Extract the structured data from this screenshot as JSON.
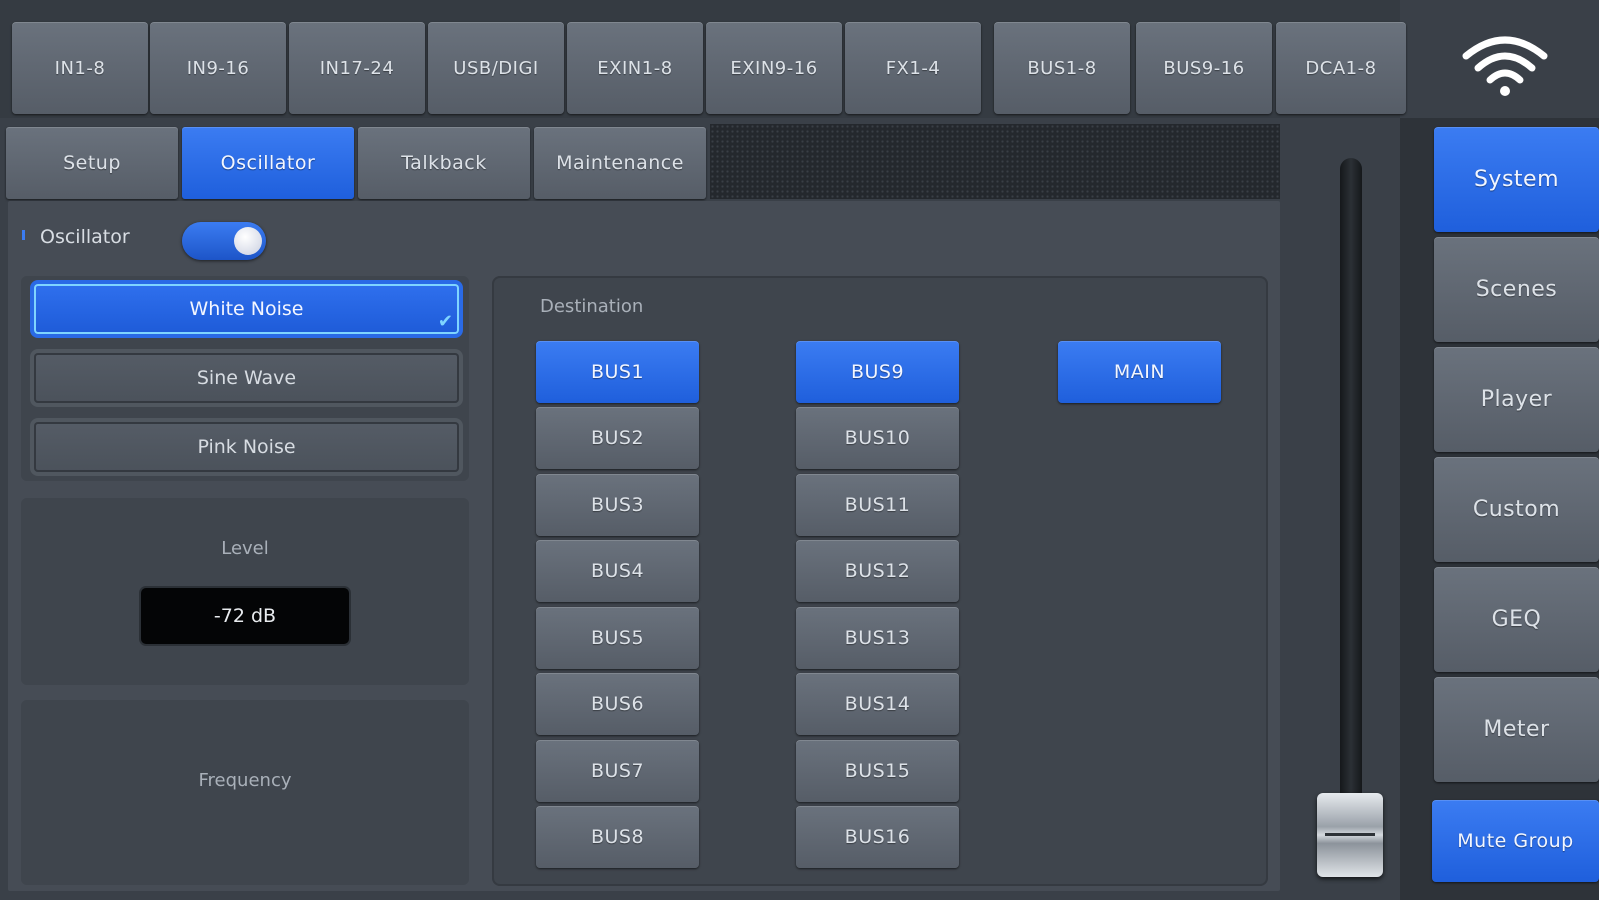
{
  "top_tabs": [
    "IN1-8",
    "IN9-16",
    "IN17-24",
    "USB/DIGI",
    "EXIN1-8",
    "EXIN9-16",
    "FX1-4",
    "BUS1-8",
    "BUS9-16",
    "DCA1-8"
  ],
  "sub_tabs": [
    "Setup",
    "Oscillator",
    "Talkback",
    "Maintenance"
  ],
  "active_sub_tab": "Oscillator",
  "oscillator": {
    "label": "Oscillator",
    "enabled": true,
    "waves": [
      "White Noise",
      "Sine Wave",
      "Pink Noise"
    ],
    "selected_wave": "White Noise",
    "level_label": "Level",
    "level_value": "-72 dB",
    "frequency_label": "Frequency"
  },
  "destination": {
    "label": "Destination",
    "col1": [
      "BUS1",
      "BUS2",
      "BUS3",
      "BUS4",
      "BUS5",
      "BUS6",
      "BUS7",
      "BUS8"
    ],
    "col2": [
      "BUS9",
      "BUS10",
      "BUS11",
      "BUS12",
      "BUS13",
      "BUS14",
      "BUS15",
      "BUS16"
    ],
    "main": "MAIN",
    "active": [
      "BUS1",
      "BUS9",
      "MAIN"
    ]
  },
  "right_nav": [
    "System",
    "Scenes",
    "Player",
    "Custom",
    "GEQ",
    "Meter"
  ],
  "active_nav": "System",
  "mute_group": "Mute Group",
  "colors": {
    "accent": "#2a6ae6",
    "panel": "#464c55",
    "background": "#3a4048"
  },
  "icons": {
    "wifi": "wifi-icon",
    "check": "check-icon"
  }
}
